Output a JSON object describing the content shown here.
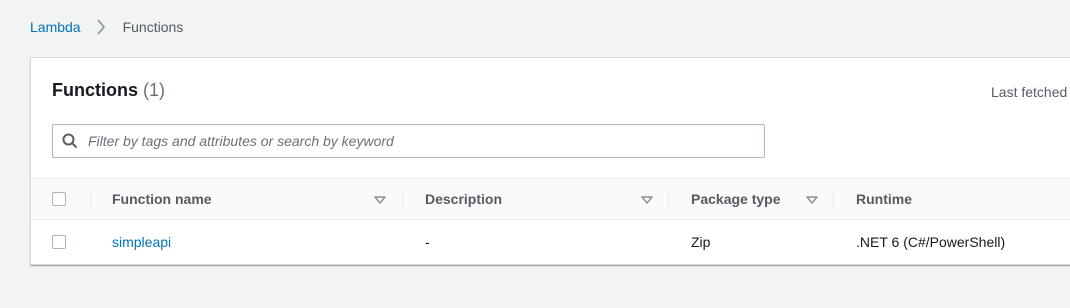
{
  "breadcrumb": {
    "items": [
      {
        "label": "Lambda"
      },
      {
        "label": "Functions"
      }
    ]
  },
  "panel": {
    "title": "Functions",
    "count": "(1)",
    "last_fetched": "Last fetched"
  },
  "search": {
    "placeholder": "Filter by tags and attributes or search by keyword",
    "value": ""
  },
  "table": {
    "columns": [
      {
        "label": "Function name",
        "sortable": true
      },
      {
        "label": "Description",
        "sortable": true
      },
      {
        "label": "Package type",
        "sortable": true
      },
      {
        "label": "Runtime",
        "sortable": false
      }
    ],
    "rows": [
      {
        "function_name": "simpleapi",
        "description": "-",
        "package_type": "Zip",
        "runtime": ".NET 6 (C#/PowerShell)"
      }
    ]
  },
  "colors": {
    "link": "#0073bb",
    "background": "#f2f3f3",
    "border": "#d5dbdb"
  }
}
